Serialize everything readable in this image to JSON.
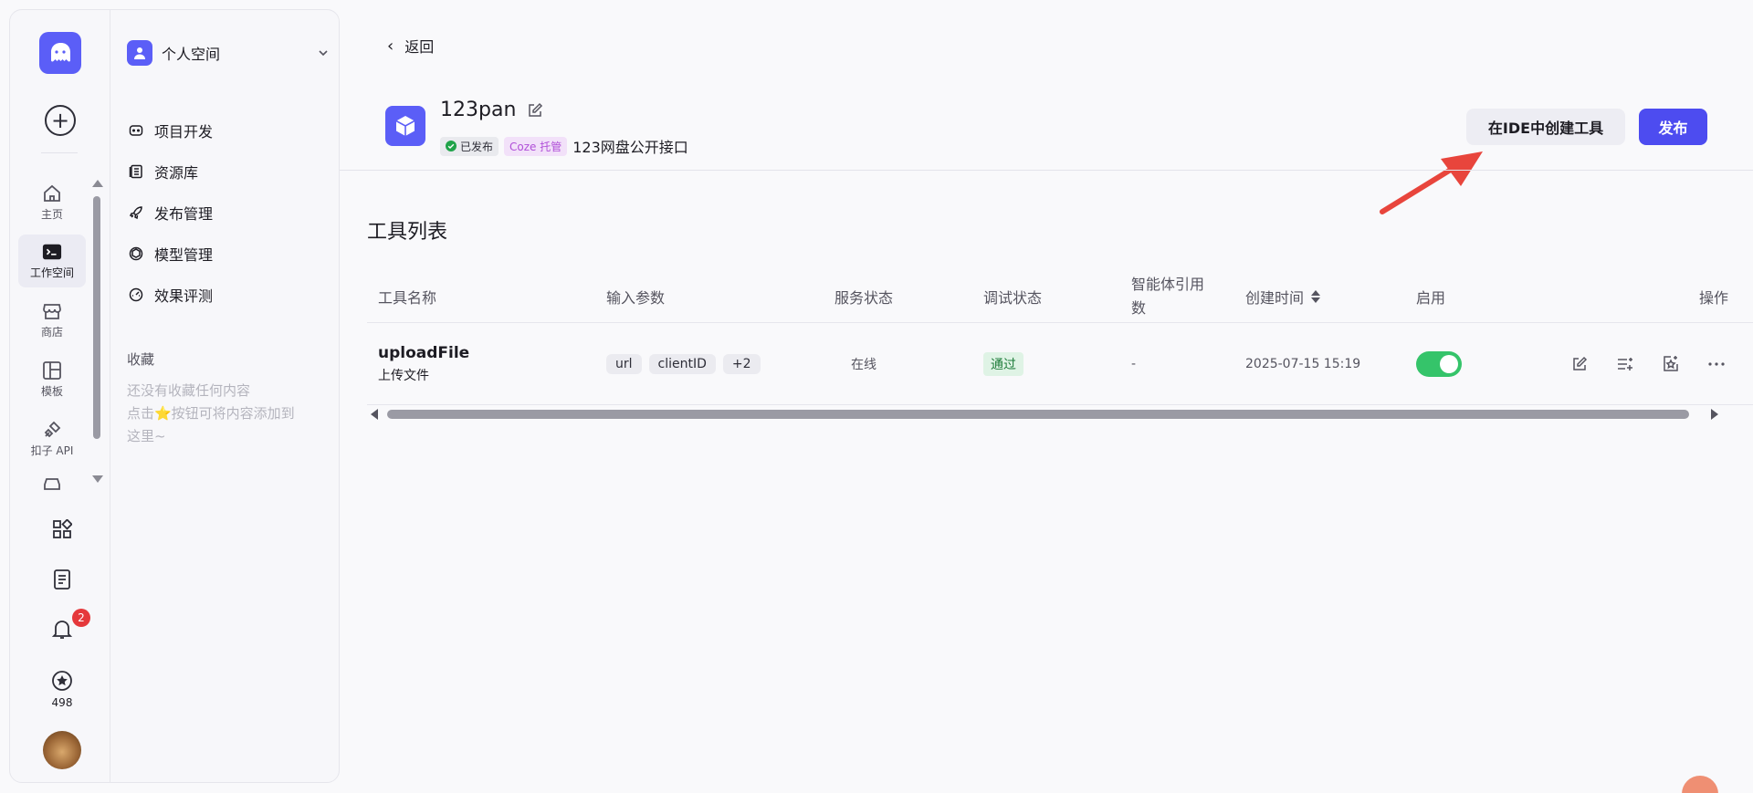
{
  "sidebar": {
    "rail": [
      {
        "label": "主页",
        "icon": "home-icon"
      },
      {
        "label": "工作空间",
        "icon": "terminal-icon",
        "active": true
      },
      {
        "label": "商店",
        "icon": "store-icon"
      },
      {
        "label": "模板",
        "icon": "template-icon"
      },
      {
        "label": "扣子 API",
        "icon": "api-icon"
      }
    ],
    "notification_count": "2",
    "star_count": "498"
  },
  "space": {
    "name": "个人空间",
    "menu": [
      {
        "label": "项目开发",
        "icon": "bot-icon"
      },
      {
        "label": "资源库",
        "icon": "library-icon"
      },
      {
        "label": "发布管理",
        "icon": "rocket-icon"
      },
      {
        "label": "模型管理",
        "icon": "cube-icon"
      },
      {
        "label": "效果评测",
        "icon": "gauge-icon"
      }
    ],
    "favorites_title": "收藏",
    "favorites_empty_1": "还没有收藏任何内容",
    "favorites_empty_2": "点击⭐按钮可将内容添加到",
    "favorites_empty_3": "这里~"
  },
  "header": {
    "back_label": "返回",
    "app_name": "123pan",
    "status_tag": "已发布",
    "host_tag": "Coze 托管",
    "description": "123网盘公开接口",
    "ide_button": "在IDE中创建工具",
    "publish_button": "发布"
  },
  "tools": {
    "section_title": "工具列表",
    "columns": [
      "工具名称",
      "输入参数",
      "服务状态",
      "调试状态",
      "智能体引用",
      "数",
      "创建时间",
      "启用",
      "操作"
    ],
    "rows": [
      {
        "name": "uploadFile",
        "desc": "上传文件",
        "params": [
          "url",
          "clientID",
          "+2"
        ],
        "service_status": "在线",
        "debug_status": "通过",
        "agent_refs": "-",
        "created": "2025-07-15 15:19",
        "enabled": true
      }
    ]
  },
  "colors": {
    "accent": "#4d4cf0",
    "brand": "#5b5ef7",
    "toggle_on": "#35c46a",
    "arrow": "#e8453c"
  }
}
